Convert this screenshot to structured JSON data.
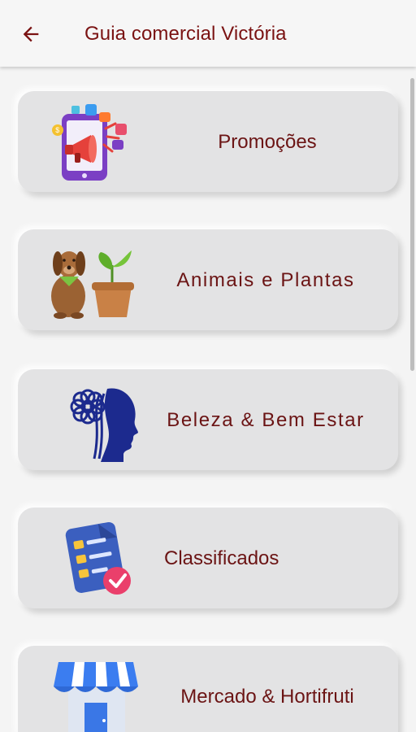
{
  "app_bar": {
    "title": "Guia comercial Victória",
    "back_icon": "arrow-left-icon"
  },
  "colors": {
    "accent": "#7a1212",
    "card_background": "#e3e3e4",
    "page_background": "#f4f4f4"
  },
  "categories": [
    {
      "label": "Promoções",
      "icon": "megaphone-phone-icon"
    },
    {
      "label": "Animais e Plantas",
      "icon": "dog-and-plant-icon"
    },
    {
      "label": "Beleza & Bem Estar",
      "icon": "flower-face-icon"
    },
    {
      "label": "Classificados",
      "icon": "checklist-icon"
    },
    {
      "label": "Mercado & Hortifruti",
      "icon": "market-stall-icon"
    }
  ]
}
